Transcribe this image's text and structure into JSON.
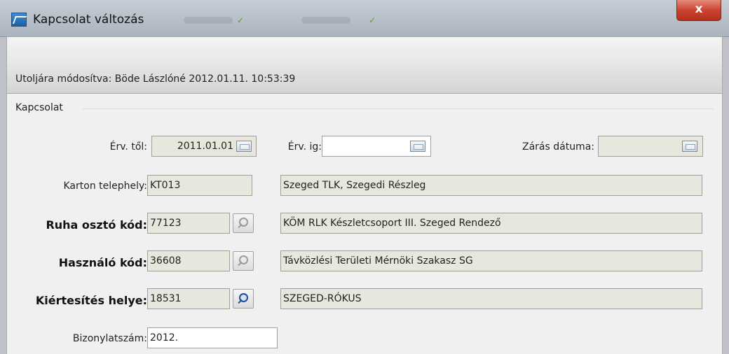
{
  "window": {
    "title": "Kapcsolat változás",
    "close_label": "x",
    "icon": "app-window-icon"
  },
  "info": {
    "last_modified": "Utoljára módosítva: Böde Lászlóné 2012.01.11. 10:53:39"
  },
  "group": {
    "label": "Kapcsolat"
  },
  "validity": {
    "from_label": "Érv. től:",
    "from_value": "2011.01.01",
    "to_label": "Érv. ig:",
    "to_value": "",
    "close_date_label": "Zárás dátuma:",
    "close_date_value": ""
  },
  "rows": {
    "karton_telephely": {
      "label": "Karton telephely:",
      "code": "KT013",
      "description": "Szeged TLK, Szegedi Részleg"
    },
    "ruha_oszto": {
      "label": "Ruha osztó kód:",
      "code": "77123",
      "description": "KÖM RLK Készletcsoport III. Szeged Rendező"
    },
    "hasznalo": {
      "label": "Használó kód:",
      "code": "36608",
      "description": "Távközlési Területi Mérnöki Szakasz SG"
    },
    "kiertesites": {
      "label": "Kiértesítés helye:",
      "code": "18531",
      "description": "SZEGED-RÓKUS"
    }
  },
  "document": {
    "label": "Bizonylatszám:",
    "value": "2012."
  }
}
